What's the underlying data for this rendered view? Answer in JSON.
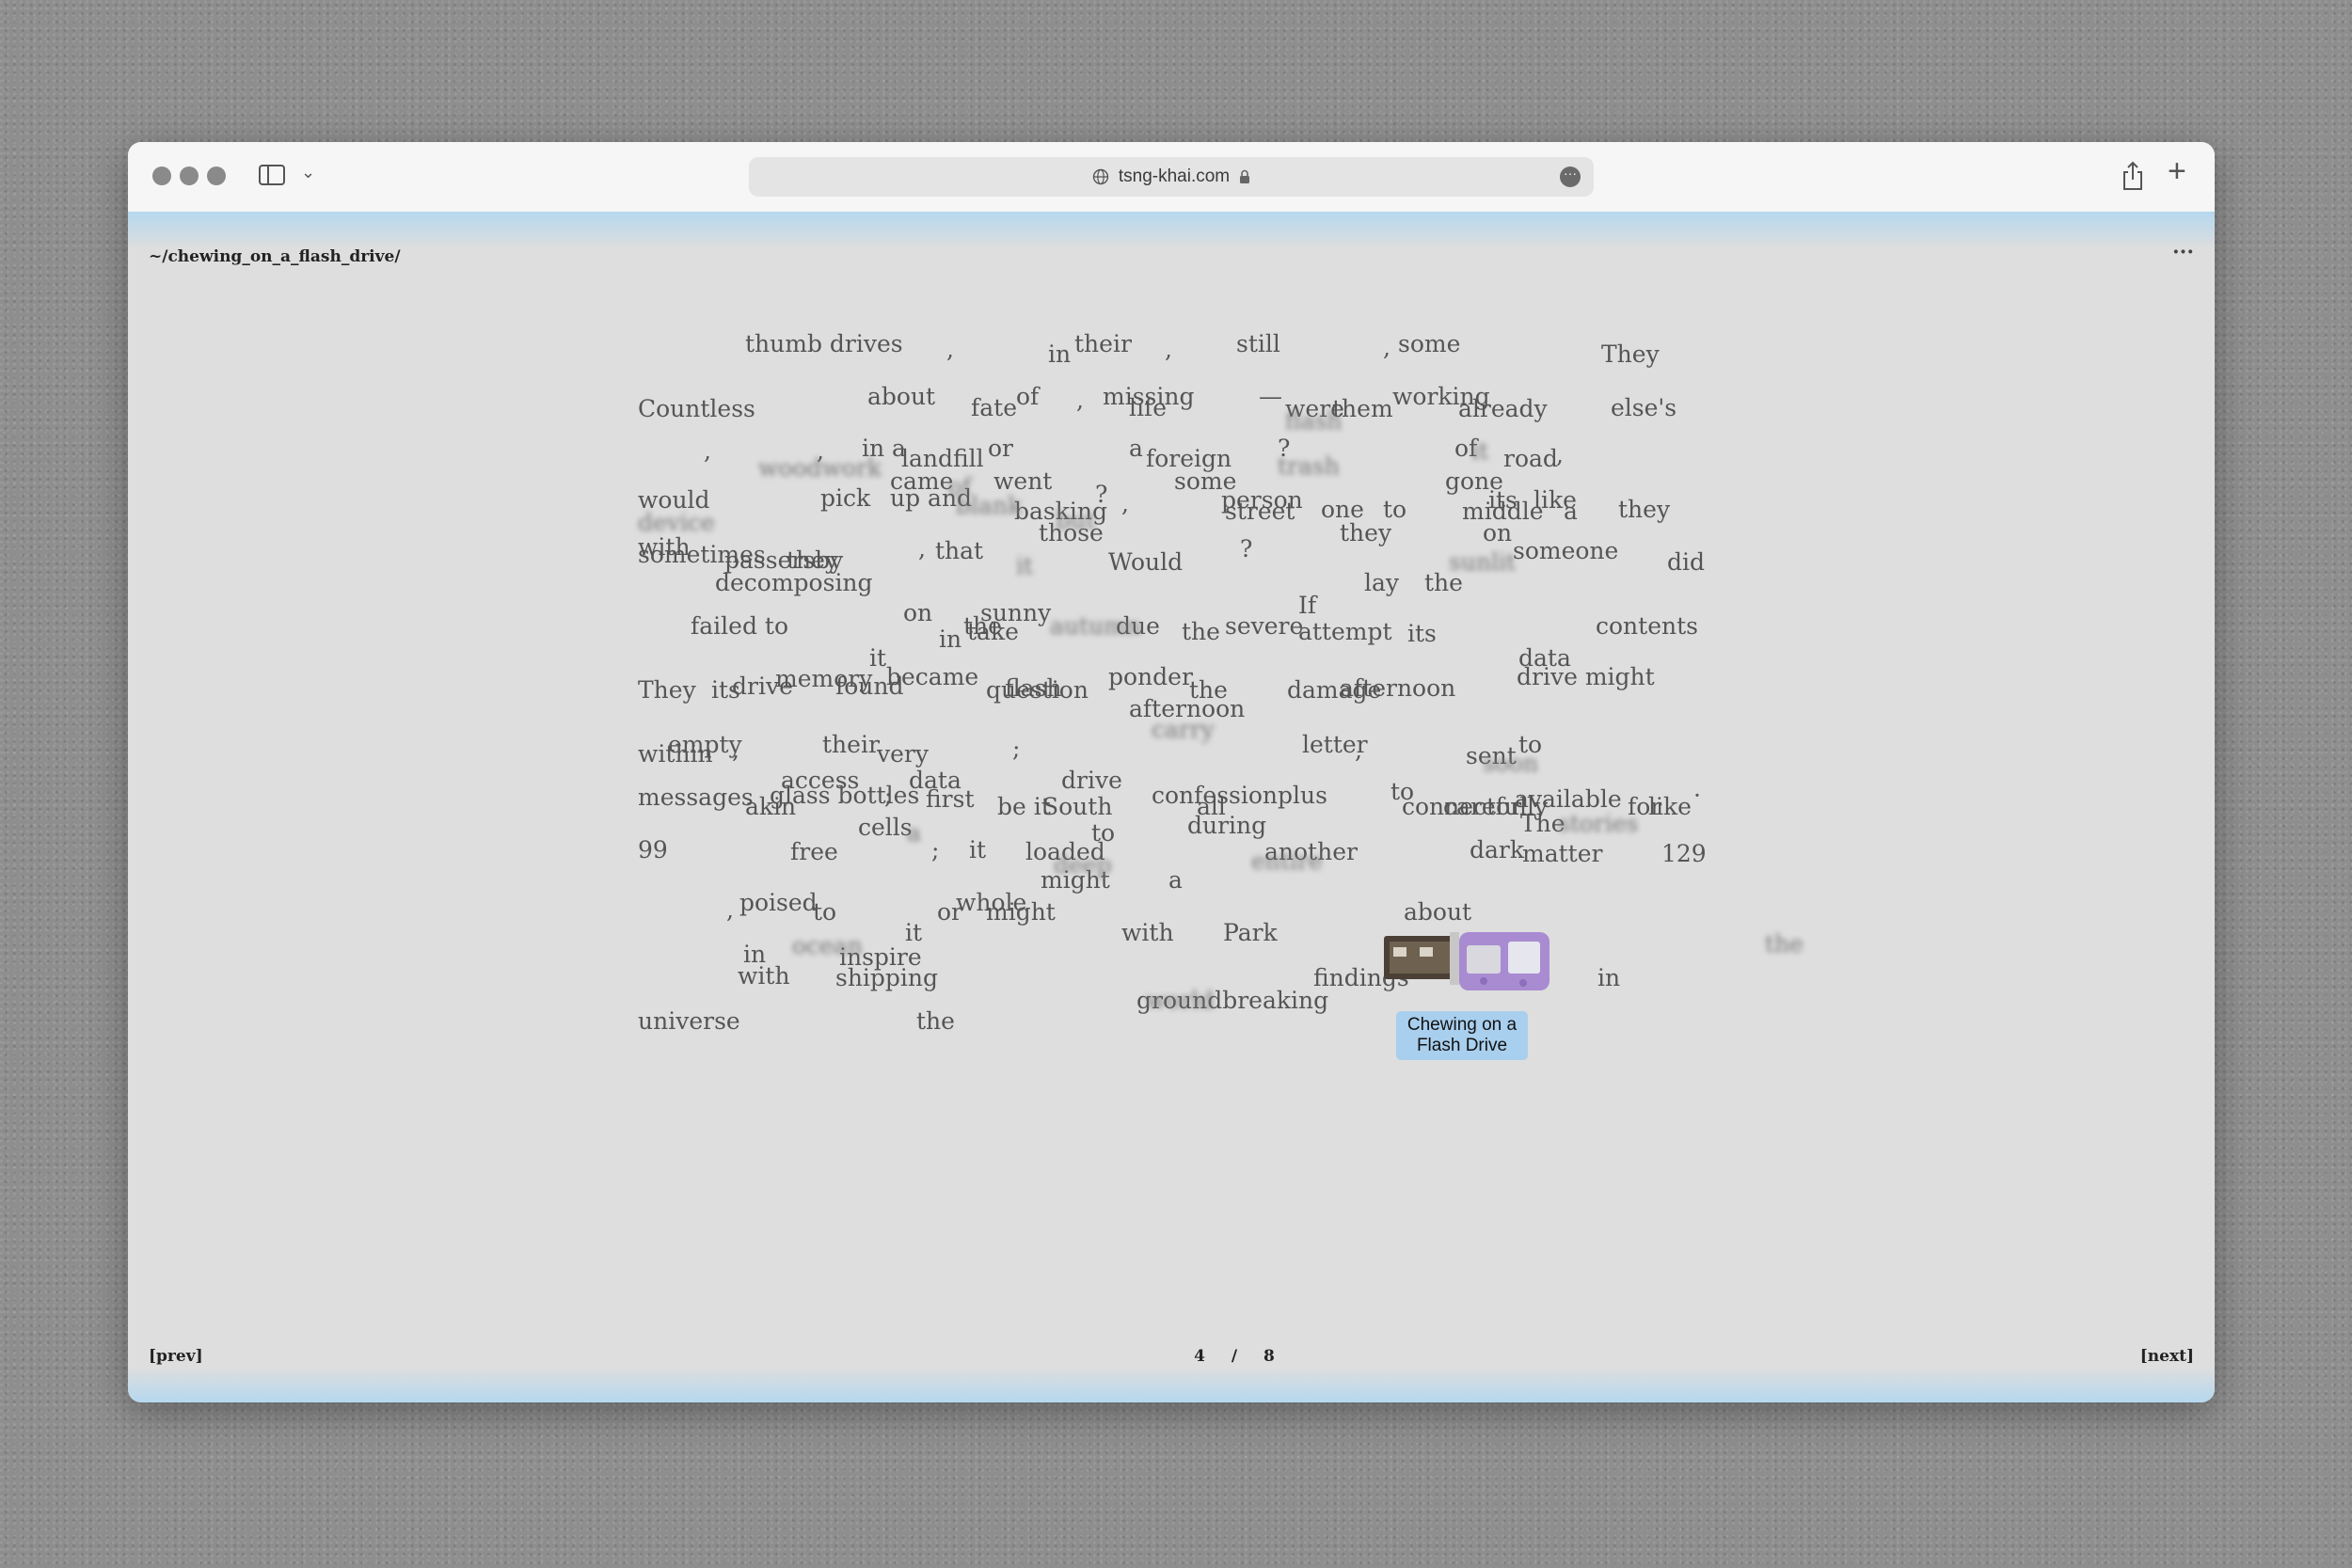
{
  "browser": {
    "url": "tsng-khai.com",
    "colors": {
      "band": "#b5d8ee",
      "page_bg": "#dedede",
      "titlebar": "#f6f6f6"
    }
  },
  "page": {
    "path": "~/chewing_on_a_flash_drive/",
    "menu": "···",
    "prev": "[prev]",
    "next": "[next]",
    "current_page": "4",
    "page_separator": "/",
    "total_pages": "8",
    "caption": "Chewing on a Flash Drive"
  },
  "words": [
    "thumb drives",
    ",",
    "in",
    "their",
    ",",
    "still",
    ",",
    "some",
    "They",
    "Countless",
    "about",
    "fate",
    "of",
    ",",
    "missing",
    "life",
    "—",
    "were",
    "them",
    "working",
    "already",
    "else's",
    ",",
    ",",
    "in a",
    "landfill",
    "or",
    "a",
    "foreign",
    "?",
    "of",
    "road",
    ",",
    "came",
    "went",
    "some",
    "gone",
    "would",
    "pick",
    "up and",
    "basking",
    "?",
    ",",
    "person",
    "one",
    "to",
    "its",
    "like",
    "they",
    "street",
    "middle",
    "a",
    "those",
    "they",
    "on",
    "with",
    "sometimes",
    "passersby",
    "they",
    ",",
    "that",
    "Would",
    "?",
    "someone",
    "did",
    "decomposing",
    "lay",
    "the",
    "failed to",
    "on",
    "the",
    "sunny",
    "due",
    "the",
    "severe",
    "If",
    "attempt",
    "its",
    "contents",
    "in",
    "take",
    "it",
    "data",
    "They",
    "its",
    "drive",
    "memory",
    "found",
    "became",
    "question",
    "flash",
    "ponder",
    "the",
    "damage",
    "afternoon",
    "drive might",
    "afternoon",
    "within",
    "empty",
    ",",
    "their",
    "very",
    ";",
    "letter",
    ",",
    "sent",
    "to",
    "access",
    "data",
    "drive",
    "to",
    "messages",
    "akin",
    "glass bottles",
    ";",
    "first",
    "be it",
    "South",
    "confession",
    "all",
    "plus",
    "connector",
    "carefully",
    "available",
    "for",
    "like",
    "·",
    "during",
    "cells",
    "to",
    "The",
    "99",
    "free",
    ";",
    "it",
    "loaded",
    "another",
    "dark",
    "matter",
    "129",
    "might",
    "a",
    ",",
    "poised",
    "to",
    "or",
    "whole",
    "might",
    "about",
    "it",
    "with",
    "Park",
    "in",
    "inspire",
    "with",
    "shipping",
    "findings",
    "in",
    "groundbreaking",
    "universe",
    "the",
    "woodwork",
    "blank",
    "trash",
    "flash",
    "of",
    "sunlit",
    "device",
    "but",
    "it",
    "autumn",
    "carry",
    "it",
    "soon",
    "stories",
    "a",
    "entire",
    "deep",
    "world",
    "the",
    "ocean"
  ]
}
